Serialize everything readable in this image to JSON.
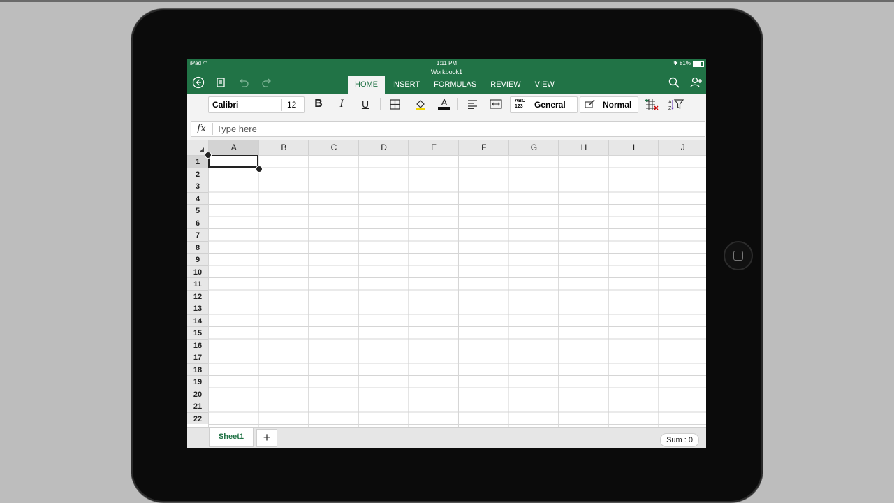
{
  "status_bar": {
    "device": "iPad",
    "time": "1:11 PM",
    "battery": "81%"
  },
  "workbook_title": "Workbook1",
  "ribbon_tabs": [
    {
      "label": "HOME",
      "active": true
    },
    {
      "label": "INSERT",
      "active": false
    },
    {
      "label": "FORMULAS",
      "active": false
    },
    {
      "label": "REVIEW",
      "active": false
    },
    {
      "label": "VIEW",
      "active": false
    }
  ],
  "toolbar": {
    "font_name": "Calibri",
    "font_size": "12",
    "bold_label": "B",
    "italic_label": "I",
    "underline_label": "U",
    "font_color_label": "A",
    "number_format_icon": "ABC\n123",
    "number_format": "General",
    "cell_style": "Normal"
  },
  "formula_bar": {
    "fx_label": "fx",
    "placeholder": "Type here"
  },
  "columns": [
    "A",
    "B",
    "C",
    "D",
    "E",
    "F",
    "G",
    "H",
    "I",
    "J"
  ],
  "rows": [
    "1",
    "2",
    "3",
    "4",
    "5",
    "6",
    "7",
    "8",
    "9",
    "10",
    "11",
    "12",
    "13",
    "14",
    "15",
    "16",
    "17",
    "18",
    "19",
    "20",
    "21",
    "22"
  ],
  "selected_cell": "A1",
  "sheets": [
    {
      "label": "Sheet1",
      "active": true
    }
  ],
  "add_sheet_label": "+",
  "status": {
    "sum": "Sum : 0"
  },
  "colors": {
    "brand_green": "#217346"
  }
}
